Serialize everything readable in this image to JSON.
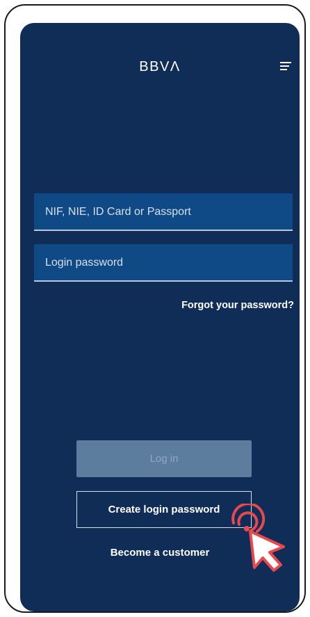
{
  "header": {
    "logo_text": "BBVΛ",
    "menu_icon": "hamburger-menu-icon"
  },
  "form": {
    "id_placeholder": "NIF, NIE, ID Card or Passport",
    "password_placeholder": "Login password",
    "forgot_link": "Forgot your password?"
  },
  "actions": {
    "login_label": "Log in",
    "create_label": "Create login password",
    "become_label": "Become a customer"
  },
  "overlay": {
    "cursor_icon": "pointer-click-icon"
  },
  "colors": {
    "background": "#0f2d57",
    "input_bg": "#0f4a86",
    "login_disabled": "#5c7d9e",
    "cursor_accent": "#e8494e"
  }
}
